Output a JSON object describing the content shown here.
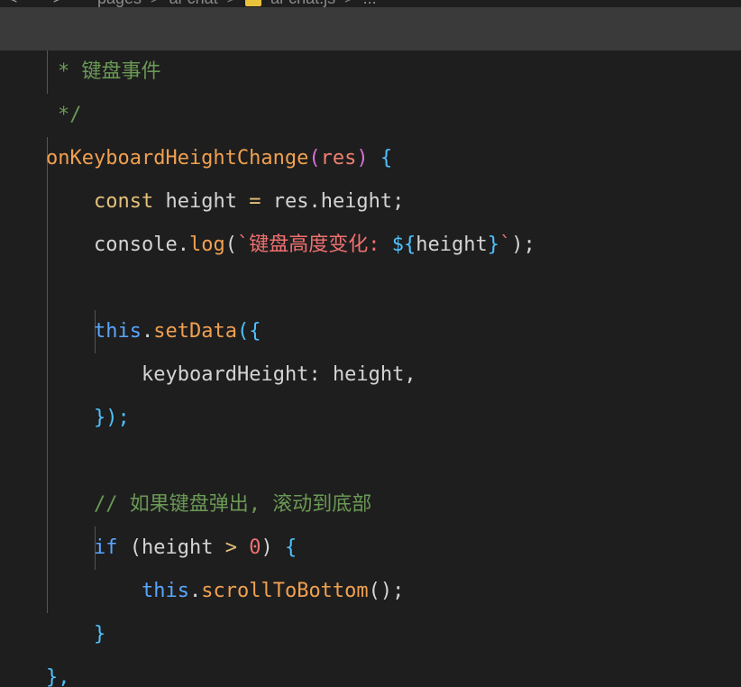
{
  "breadcrumb": {
    "nav_back": "<",
    "nav_forward": ">",
    "items": [
      "pages",
      "ai-chat",
      "ai-chat.js",
      "..."
    ],
    "separator": ">"
  },
  "code": {
    "comment_title": "* 键盘事件",
    "comment_end": "*/",
    "fn_name": "onKeyboardHeightChange",
    "fn_paren_open": "(",
    "fn_param": "res",
    "fn_paren_close": ")",
    "fn_brace_open": "{",
    "const_kw": "const",
    "var_height": "height",
    "eq": "=",
    "res_height": "res.height;",
    "console": "console.",
    "log": "log",
    "log_paren_open": "(",
    "tpl_string": "`键盘高度变化: ",
    "tpl_interp_open": "${",
    "tpl_var": "height",
    "tpl_interp_close": "}",
    "tpl_end": "`",
    "log_close": ");",
    "this_kw": "this",
    "dot": ".",
    "set_data": "setData",
    "set_data_open": "({",
    "prop_name": "keyboardHeight",
    "prop_colon": ":",
    "prop_value": "height,",
    "set_data_close": "});",
    "comment_scroll": "// 如果键盘弹出, 滚动到底部",
    "if_kw": "if",
    "if_paren_open": "(",
    "if_var": "height",
    "if_op": ">",
    "if_num": "0",
    "if_paren_close": ")",
    "if_brace_open": "{",
    "scroll_method": "scrollToBottom",
    "scroll_call_end": "();",
    "if_brace_close": "}",
    "fn_brace_close": "},"
  }
}
